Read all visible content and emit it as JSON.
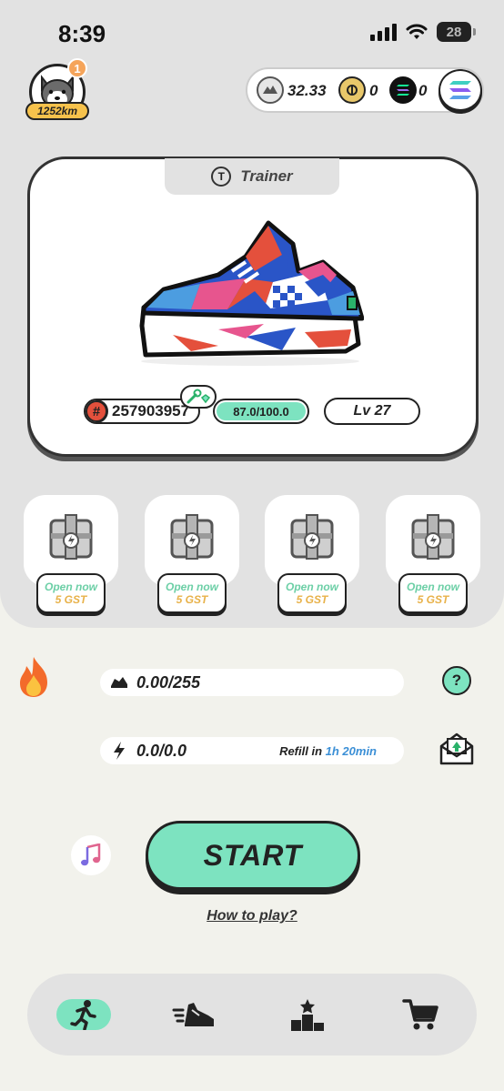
{
  "status_bar": {
    "time": "8:39",
    "battery": "28"
  },
  "profile": {
    "notification_count": "1",
    "distance": "1252km"
  },
  "balances": {
    "gst": "32.33",
    "gmt": "0",
    "sol": "0"
  },
  "sneaker": {
    "type_icon": "T",
    "type": "Trainer",
    "id_prefix": "#",
    "id": "257903957",
    "durability": "87.0/100.0",
    "durability_fraction": 0.87,
    "level": "Lv 27"
  },
  "mystery_boxes": [
    {
      "label": "Open now",
      "price": "5 GST"
    },
    {
      "label": "Open now",
      "price": "5 GST"
    },
    {
      "label": "Open now",
      "price": "5 GST"
    },
    {
      "label": "Open now",
      "price": "5 GST"
    }
  ],
  "stats": {
    "daily_gst": "0.00/255",
    "energy": "0.0/0.0",
    "refill_label": "Refill in",
    "refill_time": "1h 20min",
    "help_label": "?"
  },
  "actions": {
    "start_label": "START",
    "how_to_play": "How to play?"
  },
  "colors": {
    "accent": "#7de3c0",
    "gst_yellow": "#e8b24a",
    "refill_blue": "#3b8fd6",
    "id_red": "#e4503c"
  },
  "nav": [
    "run-icon",
    "sneaker-icon",
    "leaderboard-icon",
    "cart-icon"
  ]
}
